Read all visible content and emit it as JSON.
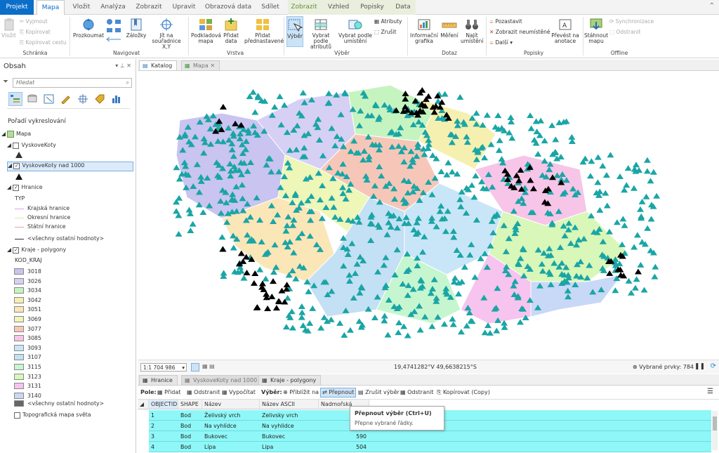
{
  "tabs": [
    "Projekt",
    "Mapa",
    "Vložit",
    "Analýza",
    "Zobrazit",
    "Upravit",
    "Obrazová data",
    "Sdílet",
    "Zobrazit",
    "Vzhled",
    "Popisky",
    "Data"
  ],
  "ribbon": {
    "clipboard": {
      "paste": "Vložit",
      "cut": "Vyjmout",
      "copy": "Kopírovat",
      "copy_path": "Kopírovat cestu",
      "group": "Schránka"
    },
    "navigate": {
      "explore": "Prozkoumat",
      "bookmarks": "Záložky",
      "goto": "Jít na souřadnice X,Y",
      "group": "Navigovat"
    },
    "layer": {
      "basemap": "Podkladová mapa",
      "add_data": "Přidat data",
      "add_preset": "Přidat přednastavené",
      "group": "Vrstva"
    },
    "selection": {
      "select": "Výběr",
      "by_attr": "Vybrat podle atributů",
      "by_loc": "Vybrat podle umístění",
      "attributes": "Atributy",
      "clear": "Zrušit",
      "group": "Výběr"
    },
    "inquiry": {
      "infographic": "Informační grafika",
      "measure": "Měření",
      "locate": "Najít umístění",
      "group": "Dotaz"
    },
    "labeling": {
      "pause": "Pozastavit",
      "show_unplaced": "Zobrazit neumístěné",
      "more": "Další",
      "convert": "Převést na anotace",
      "group": "Popisky"
    },
    "offline": {
      "download": "Stáhnout mapu",
      "sync": "Synchronizace",
      "remove": "Odstranit",
      "group": "Offline"
    }
  },
  "contents": {
    "title": "Obsah",
    "search_placeholder": "Hledat",
    "drawing_order": "Pořadí vykreslování",
    "map": "Mapa",
    "layer1": "VyskoveKoty",
    "layer2": "VyskoveKoty nad 1000",
    "layer3": "Hranice",
    "typ": "TYP",
    "line1": "Krajská hranice",
    "line2": "Okresní hranice",
    "line3": "Státní hranice",
    "others": "<všechny ostatní hodnoty>",
    "layer4": "Kraje - polygony",
    "kod": "KOD_KRAJ",
    "codes": [
      "3018",
      "3026",
      "3034",
      "3042",
      "3051",
      "3069",
      "3077",
      "3085",
      "3093",
      "3107",
      "3115",
      "3123",
      "3131",
      "3140"
    ],
    "code_colors": [
      "#c9c4f0",
      "#d6d0f4",
      "#c6f4c0",
      "#f6f0b0",
      "#fbe6b8",
      "#eef6b8",
      "#f6c7b8",
      "#f7c5e8",
      "#c8e6f7",
      "#c4e0f4",
      "#c6f6cf",
      "#d8f7b8",
      "#f6c4ee",
      "#c8d8f7"
    ],
    "others2": "<všechny ostatní hodnoty>",
    "topo": "Topografická mapa světa"
  },
  "doc_tabs": {
    "catalog": "Katalog",
    "map": "Mapa"
  },
  "map_status": {
    "scale": "1:1 704 986",
    "coords": "19,4741282°V 49,6638215°S",
    "selected": "Vybrané prvky: 784"
  },
  "table_tabs": {
    "t1": "Hranice",
    "t2": "VyskoveKoty nad 1000",
    "t3": "Kraje - polygony"
  },
  "table_toolbar": {
    "field": "Pole:",
    "add": "Přidat",
    "delete": "Odstranit",
    "calc": "Vypočítat",
    "sel": "Výběr:",
    "zoom": "Přiblížit na",
    "switch": "Přepnout",
    "clear": "Zrušit výběr",
    "del2": "Odstranit",
    "copy": "Kopírovat (Copy)"
  },
  "columns": [
    "OBJECTID",
    "SHAPE",
    "Název",
    "Název ASCII",
    "Nadmořská výška"
  ],
  "rows": [
    [
      "1",
      "Bod",
      "Želivský vrch",
      "Zelivsky vrch",
      ""
    ],
    [
      "2",
      "Bod",
      "Na vyhlídce",
      "Na vyhlidce",
      ""
    ],
    [
      "3",
      "Bod",
      "Bukovec",
      "Bukovec",
      "590"
    ],
    [
      "4",
      "Bod",
      "Lípa",
      "Lipa",
      "504"
    ]
  ],
  "tooltip": {
    "title": "Přepnout výběr (Ctrl+U)",
    "body": "Přepne vybrané řádky."
  }
}
